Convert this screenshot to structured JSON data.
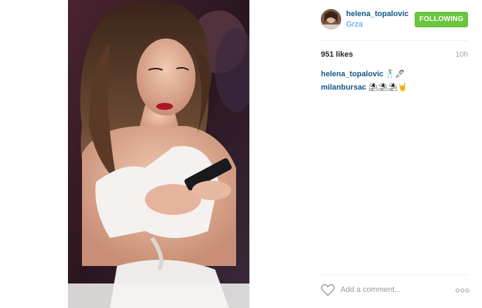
{
  "post": {
    "username": "helena_topalovic",
    "location": "Grza",
    "follow_label": "FOLLOWING",
    "likes": "951 likes",
    "time": "10h",
    "comments": [
      {
        "author": "helena_topalovic",
        "text": "🕺🖊"
      },
      {
        "author": "milanbursac",
        "text": "⛱⛱⛱🤘"
      }
    ],
    "add_comment_placeholder": "Add a comment...",
    "icons": {
      "like": "heart-icon",
      "options": "more-icon"
    },
    "colors": {
      "follow_bg": "#6bc63f",
      "link": "#125688",
      "location": "#3897f0"
    }
  }
}
